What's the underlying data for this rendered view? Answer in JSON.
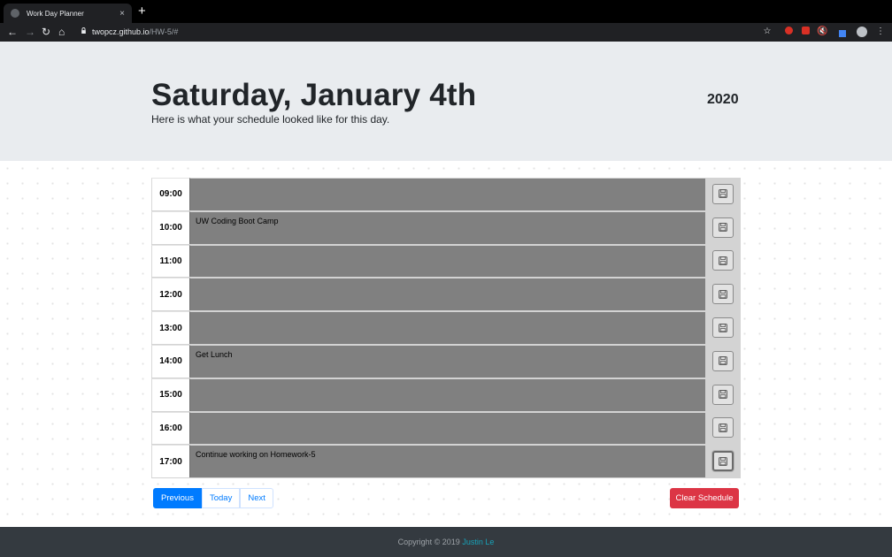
{
  "browser": {
    "tab_title": "Work Day Planner",
    "tab_close": "×",
    "new_tab": "+",
    "url_host": "twopcz.github.io",
    "url_path": "/HW-5/#"
  },
  "header": {
    "date": "Saturday, January 4th",
    "year": "2020",
    "subtitle": "Here is what your schedule looked like for this day."
  },
  "schedule": [
    {
      "hour": "09:00",
      "task": ""
    },
    {
      "hour": "10:00",
      "task": "UW Coding Boot Camp"
    },
    {
      "hour": "11:00",
      "task": ""
    },
    {
      "hour": "12:00",
      "task": ""
    },
    {
      "hour": "13:00",
      "task": ""
    },
    {
      "hour": "14:00",
      "task": "Get Lunch"
    },
    {
      "hour": "15:00",
      "task": ""
    },
    {
      "hour": "16:00",
      "task": ""
    },
    {
      "hour": "17:00",
      "task": "Continue working on Homework-5"
    }
  ],
  "controls": {
    "previous": "Previous",
    "today": "Today",
    "next": "Next",
    "clear": "Clear Schedule"
  },
  "footer": {
    "copyright": "Copyright © 2019",
    "author": "Justin Le"
  },
  "colors": {
    "primary": "#007bff",
    "danger": "#dc3545",
    "past_hour": "#808080",
    "footer_bg": "#343a40",
    "jumbotron_bg": "#e9ecef"
  }
}
